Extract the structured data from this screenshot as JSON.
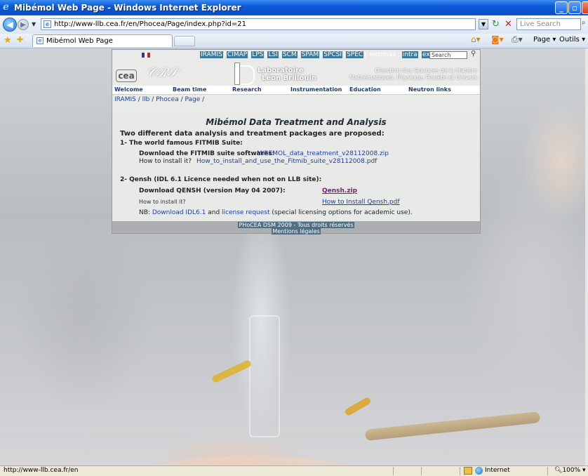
{
  "window": {
    "title": "Mibémol Web Page - Windows Internet Explorer"
  },
  "address_bar": {
    "url": "http://www-llb.cea.fr/en/Phocea/Page/index.php?id=21",
    "search_placeholder": "Live Search"
  },
  "tabs": [
    {
      "label": "Mibémol Web Page"
    }
  ],
  "command_bar": {
    "page_label": "Page ▾",
    "tools_label": "Outils ▾"
  },
  "site": {
    "top_links": [
      "IRAMIS",
      "CIMAP",
      "LPS",
      "LSI",
      "SCM",
      "SPAM",
      "SPCSI",
      "SPEC"
    ],
    "webmail_label": "webmail :",
    "intra": "intra",
    "extra": "extra",
    "search_value": "Search",
    "logo_cea": "cea",
    "lab_name_line1": "Laboratoire",
    "lab_name_line2": "Léon Brillouin",
    "dsm_line1": "Direction des Sciences de la Matière",
    "dsm_line2": "Mathématiques, Physique, Planète et Univers",
    "nav": [
      "Welcome",
      "Beam time",
      "Research",
      "Instrumentation",
      "Education",
      "Neutron links"
    ],
    "breadcrumb": [
      "IRAMIS",
      "llb",
      "Phocea",
      "Page"
    ]
  },
  "content": {
    "title": "Mibémol Data Treatment and Analysis",
    "intro": "Two different data analysis and treatment packages are proposed:",
    "section1": {
      "heading": "1- The world famous FITMIB Suite:",
      "download_label": "Download the FITMIB suite softwares:",
      "download_link": "MIBEMOL_data_treatment_v28112008.zip",
      "install_label": "How to install it?",
      "install_link": "How_to_install_and_use_the_Fitmib_suite_v28112008.pdf"
    },
    "section2": {
      "heading": "2- Qensh (IDL 6.1 Licence needed when not on LLB site):",
      "download_label": "Download QENSH (version May 04 2007):",
      "download_link": "Qensh.zip",
      "install_label": "How to install it?",
      "install_link": "How to Install Qensh.pdf",
      "nb_prefix": "NB:",
      "nb_link1": "Download IDL6.1",
      "nb_and": "and",
      "nb_link2": "license request",
      "nb_suffix": "(special licensing options for academic use)."
    }
  },
  "footer": {
    "line1": "PHoCEA DSM 2009 - Tous droits réservés",
    "line2": "Mentions légales"
  },
  "status_bar": {
    "url": "http://www-llb.cea.fr/en",
    "zone": "Internet",
    "zoom": "100%"
  }
}
